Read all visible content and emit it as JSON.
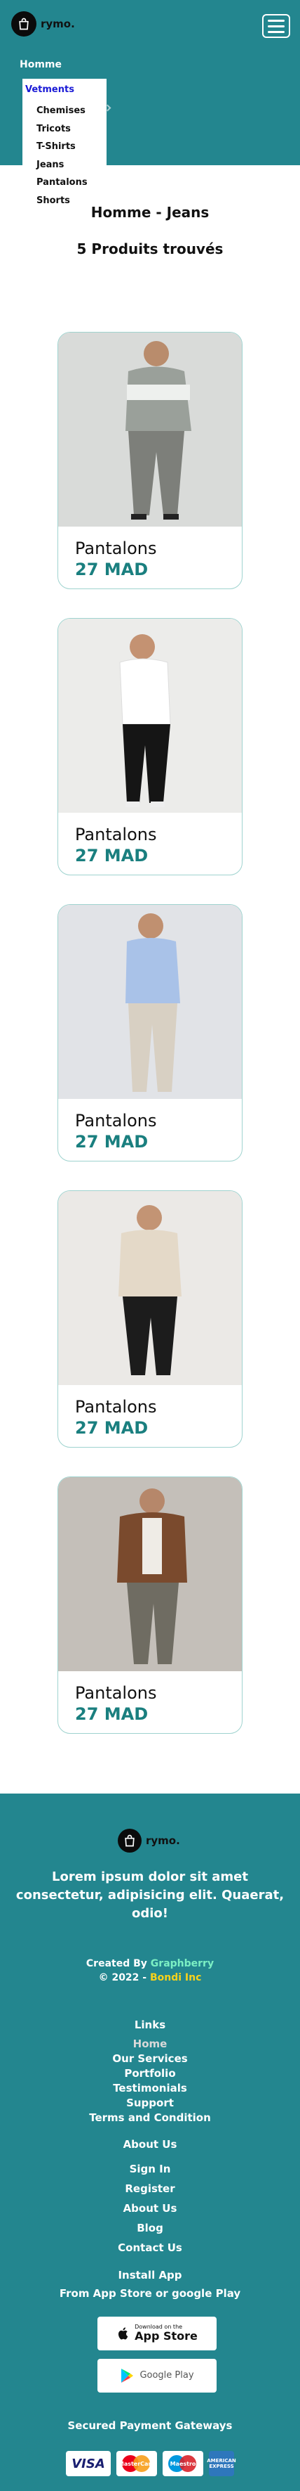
{
  "header": {
    "brand": "rymo.",
    "nav_home": "Homme",
    "dropdown": {
      "title": "Vetments",
      "items": [
        "Chemises",
        "Tricots",
        "T-Shirts",
        "Jeans",
        "Pantalons",
        "Shorts"
      ]
    }
  },
  "main": {
    "title": "Homme - Jeans",
    "results": "5 Produits trouvés",
    "products": [
      {
        "name": "Pantalons",
        "price": "27 MAD"
      },
      {
        "name": "Pantalons",
        "price": "27 MAD"
      },
      {
        "name": "Pantalons",
        "price": "27 MAD"
      },
      {
        "name": "Pantalons",
        "price": "27 MAD"
      },
      {
        "name": "Pantalons",
        "price": "27 MAD"
      }
    ]
  },
  "footer": {
    "brand": "rymo.",
    "tagline": "Lorem ipsum dolor sit amet consectetur, adipisicing elit. Quaerat, odio!",
    "created_prefix": "Created By",
    "created_by": "Graphberry",
    "copyright_prefix": "© 2022 -",
    "copyright_name": "Bondi Inc",
    "links_heading": "Links",
    "links": [
      "Home",
      "Our Services",
      "Portfolio",
      "Testimonials",
      "Support",
      "Terms and Condition"
    ],
    "about_heading": "About Us",
    "about_links": [
      "Sign In",
      "Register",
      "About Us",
      "Blog",
      "Contact Us"
    ],
    "install_heading": "Install App",
    "install_sub": "From App Store or google Play",
    "appstore_small": "Download on the",
    "appstore_big": "App Store",
    "googleplay_big": "Google Play",
    "payments_heading": "Secured Payment Gateways",
    "payments": [
      "VISA",
      "MasterCard",
      "Maestro",
      "AMERICAN EXPRESS"
    ]
  },
  "colors": {
    "teal": "#23868f",
    "price": "#1a7f7f",
    "card_border": "#9fd3cf",
    "dropdown_title": "#1a1ad6",
    "created_highlight": "#7cf0c4",
    "bondi_highlight": "#f7d21b"
  }
}
